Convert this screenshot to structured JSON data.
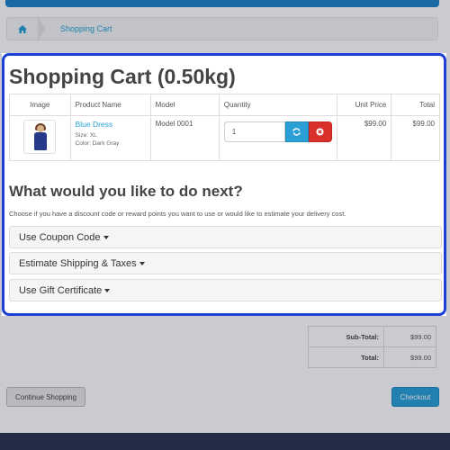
{
  "breadcrumb": {
    "home_icon": "home-icon",
    "current": "Shopping Cart"
  },
  "cart": {
    "title": "Shopping Cart  (0.50kg)",
    "columns": {
      "image": "Image",
      "product_name": "Product Name",
      "model": "Model",
      "quantity": "Quantity",
      "unit_price": "Unit Price",
      "total": "Total"
    },
    "item": {
      "name": "Blue Dress",
      "option_size": "Size: XL",
      "option_color": "Color: Dark Gray",
      "model": "Model 0001",
      "quantity": "1",
      "unit_price": "$99.00",
      "total": "$99.00",
      "update_icon": "refresh-icon",
      "remove_icon": "remove-icon"
    }
  },
  "next": {
    "title": "What would you like to do next?",
    "description": "Choose if you have a discount code or reward points you want to use or would like to estimate your delivery cost.",
    "panels": {
      "coupon": "Use Coupon Code",
      "shipping": "Estimate Shipping & Taxes",
      "voucher": "Use Gift Certificate"
    }
  },
  "totals": {
    "subtotal_label": "Sub-Total:",
    "subtotal_value": "$99.00",
    "total_label": "Total:",
    "total_value": "$99.00"
  },
  "buttons": {
    "continue": "Continue Shopping",
    "checkout": "Checkout"
  },
  "colors": {
    "accent": "#2a9fd6",
    "danger": "#d9302b",
    "highlight_border": "#1c3fd6"
  }
}
